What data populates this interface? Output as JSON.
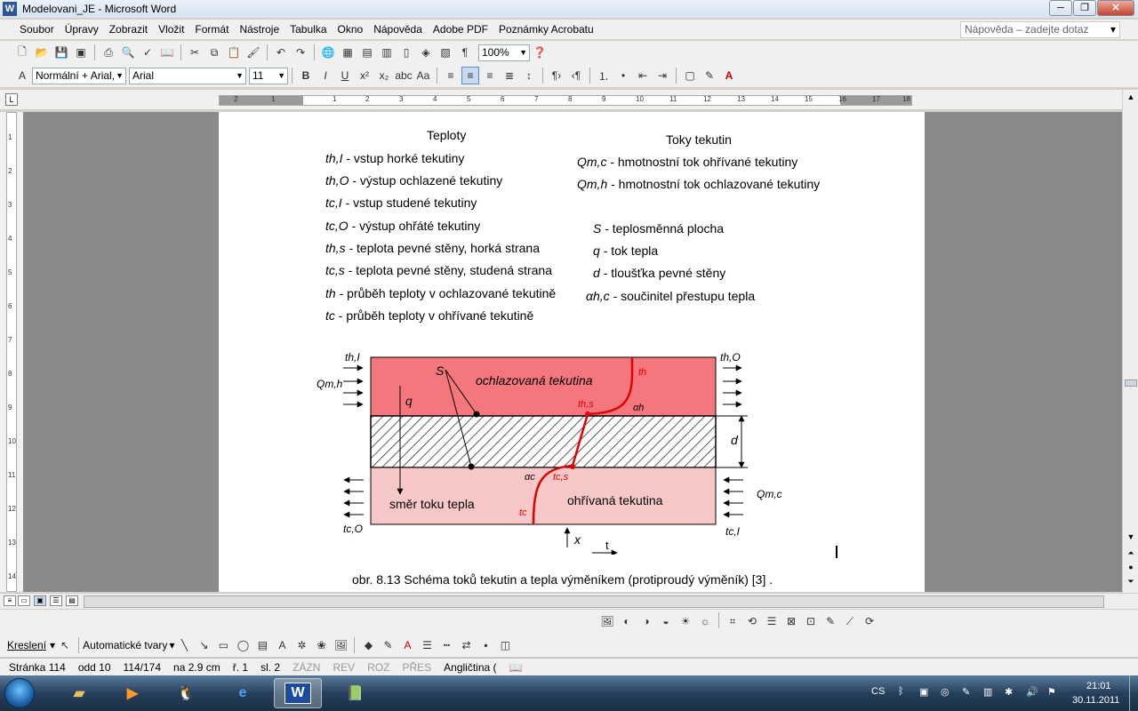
{
  "window": {
    "title": "Modelovani_JE - Microsoft Word",
    "buttons": [
      "─",
      "❐",
      "✕"
    ]
  },
  "menu": {
    "items": [
      "Soubor",
      "Úpravy",
      "Zobrazit",
      "Vložit",
      "Formát",
      "Nástroje",
      "Tabulka",
      "Okno",
      "Nápověda",
      "Adobe PDF",
      "Poznámky Acrobatu"
    ],
    "help_placeholder": "Nápověda – zadejte dotaz"
  },
  "toolbar": {
    "zoom": "100%",
    "style": "Normální + Arial,",
    "font": "Arial",
    "size": "11"
  },
  "ruler": {
    "marks": [
      "2",
      "1",
      "1",
      "2",
      "3",
      "4",
      "5",
      "6",
      "7",
      "8",
      "9",
      "10",
      "11",
      "12",
      "13",
      "14",
      "15",
      "16",
      "17",
      "18"
    ]
  },
  "vruler": {
    "marks": [
      "1",
      "2",
      "3",
      "4",
      "5",
      "6",
      "7",
      "8",
      "9",
      "10",
      "11",
      "12",
      "13",
      "14"
    ]
  },
  "doc": {
    "temps_header": "Teploty",
    "flows_header": "Toky tekutin",
    "temps": [
      {
        "sym": "th,I",
        "text": "- vstup horké tekutiny"
      },
      {
        "sym": "th,O",
        "text": "- výstup ochlazené tekutiny"
      },
      {
        "sym": "tc,I",
        "text": "- vstup studené tekutiny"
      },
      {
        "sym": "tc,O",
        "text": "- výstup ohřáté tekutiny"
      },
      {
        "sym": "th,s",
        "text": "- teplota pevné stěny, horká strana"
      },
      {
        "sym": "tc,s",
        "text": "- teplota pevné stěny, studená strana"
      },
      {
        "sym": "th",
        "text": " - průběh teploty v ochlazované tekutině"
      },
      {
        "sym": "tc",
        "text": " - průběh teploty v ohřívané tekutině"
      }
    ],
    "flows": [
      {
        "sym": "Qm,c",
        "text": "- hmotnostní tok ohřívané tekutiny"
      },
      {
        "sym": "Qm,h",
        "text": "- hmotnostní tok ochlazované tekutiny"
      }
    ],
    "others": [
      {
        "sym": "S",
        "text": "- teplosměnná plocha"
      },
      {
        "sym": "q",
        "text": "- tok tepla"
      },
      {
        "sym": "d",
        "text": "- tloušťka pevné stěny"
      },
      {
        "sym": "αh,c",
        "text": "- součinitel přestupu tepla"
      }
    ],
    "diagram": {
      "hot_fluid": "ochlazovaná tekutina",
      "cold_fluid": "ohřívaná tekutina",
      "heat_dir": "směr toku tepla",
      "S": "S",
      "q": "q",
      "d": "d",
      "x": "x",
      "t": "t",
      "thI": "th,I",
      "thO": "th,O",
      "tcO": "tc,O",
      "tcI": "tc,I",
      "Qmh": "Qm,h",
      "Qmc": "Qm,c",
      "th": "th",
      "tc": "tc",
      "ths": "th,s",
      "tcs": "tc,s",
      "ah": "αh",
      "ac": "αc"
    },
    "caption": "obr. 8.13 Schéma toků tekutin a tepla výměníkem (protiproudý výměník) [3] ."
  },
  "draw_toolbar": {
    "draw": "Kreslení",
    "autoshapes": "Automatické tvary"
  },
  "status": {
    "page": "Stránka 114",
    "section": "odd 10",
    "pages": "114/174",
    "at": "na 2.9 cm",
    "line": "ř. 1",
    "col": "sl. 2",
    "rec": "ZÁZN",
    "trk": "REV",
    "ext": "ROZ",
    "ovr": "PŘES",
    "lang": "Angličtina ("
  },
  "taskbar": {
    "lang": "CS",
    "time": "21:01",
    "date": "30.11.2011"
  },
  "colors": {
    "hot": "#f4777d",
    "cold": "#f8c8c8",
    "curve": "#e00000"
  }
}
